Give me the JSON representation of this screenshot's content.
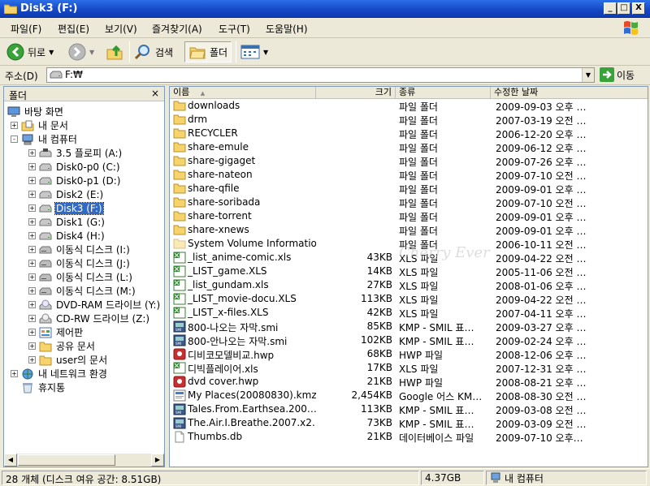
{
  "window": {
    "title": "Disk3 (F:)",
    "min_label": "_",
    "max_label": "□",
    "close_label": "X"
  },
  "menu": [
    "파일(F)",
    "편집(E)",
    "보기(V)",
    "즐겨찾기(A)",
    "도구(T)",
    "도움말(H)"
  ],
  "toolbar": {
    "back": "뒤로",
    "search": "검색",
    "folders": "폴더"
  },
  "address": {
    "label": "주소(D)",
    "value": "F:₩",
    "go": "이동"
  },
  "folders_pane": {
    "title": "폴더",
    "close": "×"
  },
  "tree": [
    {
      "label": "바탕 화면",
      "icon": "desktop-icon"
    },
    {
      "label": "내 문서",
      "icon": "my-documents-icon",
      "expander": "+"
    },
    {
      "label": "내 컴퓨터",
      "icon": "my-computer-icon",
      "expander": "-"
    },
    {
      "label": "3.5 플로피 (A:)",
      "icon": "floppy-icon",
      "expander": "+"
    },
    {
      "label": "Disk0-p0 (C:)",
      "icon": "drive-icon",
      "expander": "+"
    },
    {
      "label": "Disk0-p1 (D:)",
      "icon": "drive-icon",
      "expander": "+"
    },
    {
      "label": "Disk2 (E:)",
      "icon": "drive-icon",
      "expander": "+"
    },
    {
      "label": "Disk3 (F:)",
      "icon": "drive-icon",
      "expander": "+",
      "selected": true
    },
    {
      "label": "Disk1 (G:)",
      "icon": "drive-icon",
      "expander": "+"
    },
    {
      "label": "Disk4 (H:)",
      "icon": "drive-icon",
      "expander": "+"
    },
    {
      "label": "이동식 디스크 (I:)",
      "icon": "removable-disk-icon",
      "expander": "+"
    },
    {
      "label": "이동식 디스크 (J:)",
      "icon": "removable-disk-icon",
      "expander": "+"
    },
    {
      "label": "이동식 디스크 (L:)",
      "icon": "removable-disk-icon",
      "expander": "+"
    },
    {
      "label": "이동식 디스크 (M:)",
      "icon": "removable-disk-icon",
      "expander": "+"
    },
    {
      "label": "DVD-RAM 드라이브 (Y:)",
      "icon": "dvd-drive-icon",
      "expander": "+"
    },
    {
      "label": "CD-RW 드라이브 (Z:)",
      "icon": "cd-drive-icon",
      "expander": "+"
    },
    {
      "label": "제어판",
      "icon": "control-panel-icon",
      "expander": "+"
    },
    {
      "label": "공유 문서",
      "icon": "folder-icon",
      "expander": "+"
    },
    {
      "label": "user의 문서",
      "icon": "folder-icon",
      "expander": "+"
    },
    {
      "label": "내 네트워크 환경",
      "icon": "network-icon",
      "expander": "+"
    },
    {
      "label": "휴지통",
      "icon": "recycle-bin-icon"
    }
  ],
  "columns": {
    "name": "이름",
    "size": "크기",
    "type": "종류",
    "modified": "수정한 날짜"
  },
  "files": [
    {
      "name": "downloads",
      "size": "",
      "type": "파일 폴더",
      "modified": "2009-09-03 오후 …",
      "icon": "folder-icon"
    },
    {
      "name": "drm",
      "size": "",
      "type": "파일 폴더",
      "modified": "2007-03-19 오전 …",
      "icon": "folder-icon"
    },
    {
      "name": "RECYCLER",
      "size": "",
      "type": "파일 폴더",
      "modified": "2006-12-20 오후 …",
      "icon": "folder-icon"
    },
    {
      "name": "share-emule",
      "size": "",
      "type": "파일 폴더",
      "modified": "2009-06-12 오후 …",
      "icon": "folder-icon"
    },
    {
      "name": "share-gigaget",
      "size": "",
      "type": "파일 폴더",
      "modified": "2009-07-26 오후 …",
      "icon": "folder-icon"
    },
    {
      "name": "share-nateon",
      "size": "",
      "type": "파일 폴더",
      "modified": "2009-07-10 오전 …",
      "icon": "folder-icon"
    },
    {
      "name": "share-qfile",
      "size": "",
      "type": "파일 폴더",
      "modified": "2009-09-01 오후 …",
      "icon": "folder-icon"
    },
    {
      "name": "share-soribada",
      "size": "",
      "type": "파일 폴더",
      "modified": "2009-07-10 오전 …",
      "icon": "folder-icon"
    },
    {
      "name": "share-torrent",
      "size": "",
      "type": "파일 폴더",
      "modified": "2009-09-01 오후 …",
      "icon": "folder-icon"
    },
    {
      "name": "share-xnews",
      "size": "",
      "type": "파일 폴더",
      "modified": "2009-09-01 오후 …",
      "icon": "folder-icon"
    },
    {
      "name": "System Volume Information",
      "size": "",
      "type": "파일 폴더",
      "modified": "2006-10-11 오전 …",
      "icon": "folder-hidden-icon"
    },
    {
      "name": "_list_anime-comic.xls",
      "size": "43KB",
      "type": "XLS 파일",
      "modified": "2009-04-22 오전 …",
      "icon": "excel-file-icon"
    },
    {
      "name": "_LIST_game.XLS",
      "size": "14KB",
      "type": "XLS 파일",
      "modified": "2005-11-06 오전 …",
      "icon": "excel-file-icon"
    },
    {
      "name": "_list_gundam.xls",
      "size": "27KB",
      "type": "XLS 파일",
      "modified": "2008-01-06 오후 …",
      "icon": "excel-file-icon"
    },
    {
      "name": "_LIST_movie-docu.XLS",
      "size": "113KB",
      "type": "XLS 파일",
      "modified": "2009-04-22 오전 …",
      "icon": "excel-file-icon"
    },
    {
      "name": "_LIST_x-files.XLS",
      "size": "42KB",
      "type": "XLS 파일",
      "modified": "2007-04-11 오후 …",
      "icon": "excel-file-icon"
    },
    {
      "name": "800-나오는 자막.smi",
      "size": "85KB",
      "type": "KMP - SMIL 표…",
      "modified": "2009-03-27 오후 …",
      "icon": "smi-file-icon"
    },
    {
      "name": "800-안나오는 자막.smi",
      "size": "102KB",
      "type": "KMP - SMIL 표…",
      "modified": "2009-02-24 오후 …",
      "icon": "smi-file-icon"
    },
    {
      "name": "디비코모델비교.hwp",
      "size": "68KB",
      "type": "HWP 파일",
      "modified": "2008-12-06 오후 …",
      "icon": "hwp-file-icon"
    },
    {
      "name": "디빅플레이어.xls",
      "size": "17KB",
      "type": "XLS 파일",
      "modified": "2007-12-31 오후 …",
      "icon": "excel-file-icon"
    },
    {
      "name": "dvd cover.hwp",
      "size": "21KB",
      "type": "HWP 파일",
      "modified": "2008-08-21 오후 …",
      "icon": "hwp-file-icon"
    },
    {
      "name": "My Places(20080830).kmz",
      "size": "2,454KB",
      "type": "Google 어스 KM…",
      "modified": "2008-08-30 오전 …",
      "icon": "kmz-file-icon"
    },
    {
      "name": "Tales.From.Earthsea.200…",
      "size": "113KB",
      "type": "KMP - SMIL 표…",
      "modified": "2009-03-08 오전 …",
      "icon": "smi-file-icon"
    },
    {
      "name": "The.Air.I.Breathe.2007.x2…",
      "size": "73KB",
      "type": "KMP - SMIL 표…",
      "modified": "2009-03-09 오전 …",
      "icon": "smi-file-icon"
    },
    {
      "name": "Thumbs.db",
      "size": "21KB",
      "type": "데이터베이스 파일",
      "modified": "2009-07-10 오후…",
      "icon": "db-file-icon"
    }
  ],
  "watermark": "Cherry Ever",
  "status": {
    "count": "28 개체 (디스크 여유 공간: 8.51GB)",
    "size": "4.37GB",
    "location": "내 컴퓨터"
  }
}
